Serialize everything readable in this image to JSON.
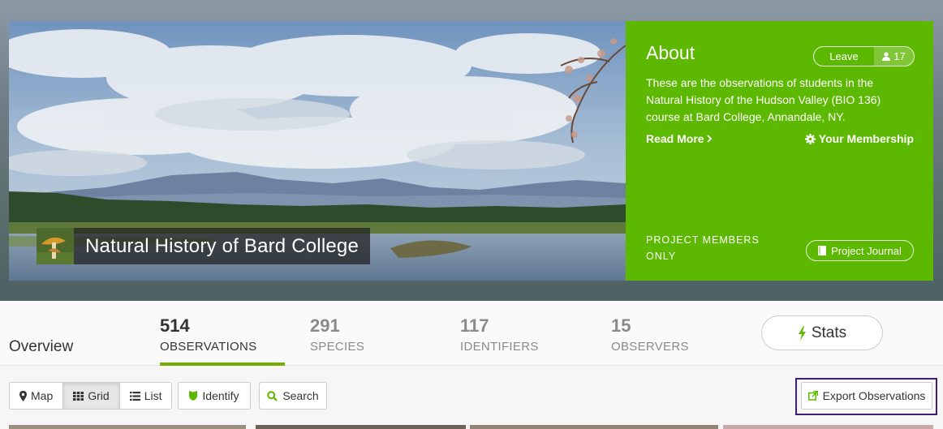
{
  "hero": {
    "project_title": "Natural History of Bard College",
    "project_icon": "mushroom-photo-icon"
  },
  "about": {
    "heading": "About",
    "leave_label": "Leave",
    "member_count": "17",
    "description": "These are the observations of students in the Natural History of the Hudson Valley (BIO 136) course at Bard College, Annandale, NY.",
    "read_more": "Read More",
    "your_membership": "Your Membership",
    "members_only": "PROJECT MEMBERS ONLY",
    "project_journal": "Project Journal",
    "panel_color": "#5cb800"
  },
  "stats": {
    "overview": "Overview",
    "items": [
      {
        "value": "514",
        "label": "OBSERVATIONS",
        "active": true
      },
      {
        "value": "291",
        "label": "SPECIES",
        "active": false
      },
      {
        "value": "117",
        "label": "IDENTIFIERS",
        "active": false
      },
      {
        "value": "15",
        "label": "OBSERVERS",
        "active": false
      }
    ],
    "stats_button": "Stats",
    "accent_color": "#74ac00"
  },
  "toolbar": {
    "views": [
      {
        "label": "Map",
        "icon": "map-marker-icon",
        "active": false
      },
      {
        "label": "Grid",
        "icon": "grid-icon",
        "active": true
      },
      {
        "label": "List",
        "icon": "list-icon",
        "active": false
      }
    ],
    "identify": "Identify",
    "search": "Search",
    "export": "Export Observations"
  }
}
